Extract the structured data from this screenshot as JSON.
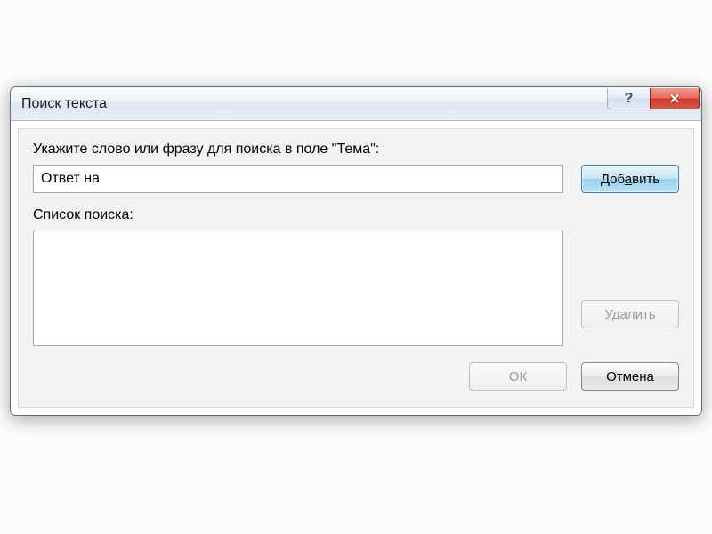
{
  "titlebar": {
    "title": "Поиск текста"
  },
  "labels": {
    "search_prompt": "Укажите слово или фразу для поиска в поле \"Тема\":",
    "search_list": "Список поиска:"
  },
  "inputs": {
    "search_value": "Ответ на"
  },
  "buttons": {
    "add": "Добавить",
    "remove": "Удалить",
    "ok": "ОК",
    "cancel": "Отмена"
  }
}
